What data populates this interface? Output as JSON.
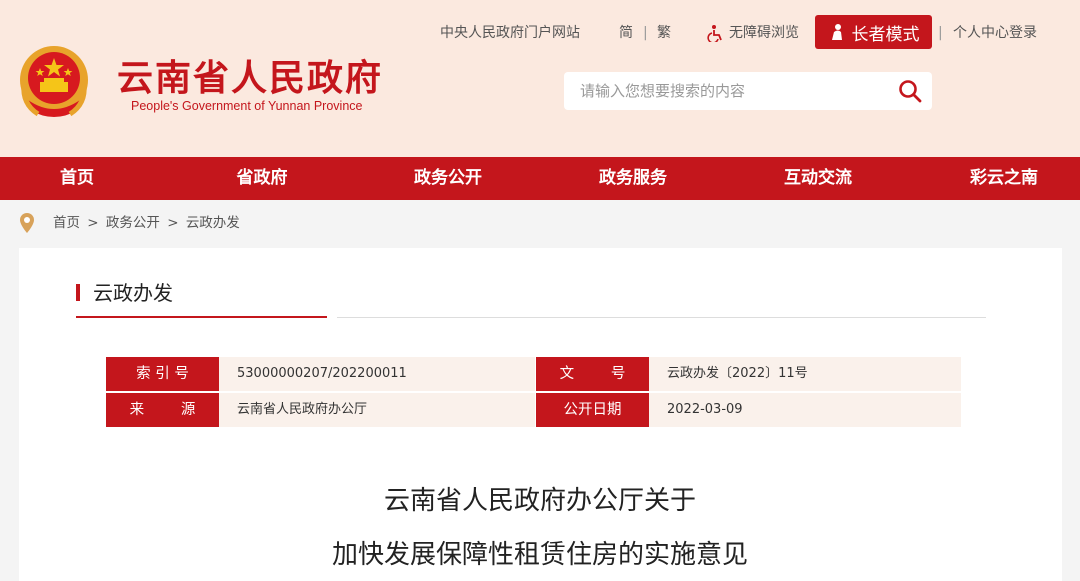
{
  "header": {
    "site_title": "云南省人民政府",
    "site_subtitle": "People's Government of Yunnan Province",
    "portal_link": "中央人民政府门户网站",
    "lang_simplified": "简",
    "lang_separator": "|",
    "lang_traditional": "繁",
    "accessibility": "无障碍浏览",
    "elder_mode": "长者模式",
    "pipe": "|",
    "login": "个人中心登录",
    "search_placeholder": "请输入您想要搜索的内容"
  },
  "nav": {
    "items": [
      "首页",
      "省政府",
      "政务公开",
      "政务服务",
      "互动交流",
      "彩云之南"
    ]
  },
  "breadcrumb": {
    "items": [
      "首页",
      ">",
      "政务公开",
      ">",
      "云政办发"
    ]
  },
  "section": {
    "title": "云政办发"
  },
  "meta": {
    "index_label": "索 引 号",
    "index_value": "53000000207/202200011",
    "doc_no_label": "文        号",
    "doc_no_value": "云政办发〔2022〕11号",
    "source_label": "来        源",
    "source_value": "云南省人民政府办公厅",
    "date_label": "公开日期",
    "date_value": "2022-03-09"
  },
  "article": {
    "title_line1": "云南省人民政府办公厅关于",
    "title_line2": "加快发展保障性租赁住房的实施意见"
  },
  "colors": {
    "brand_red": "#c4161c",
    "header_bg": "#fbe9df",
    "meta_value_bg": "#faf1eb"
  }
}
